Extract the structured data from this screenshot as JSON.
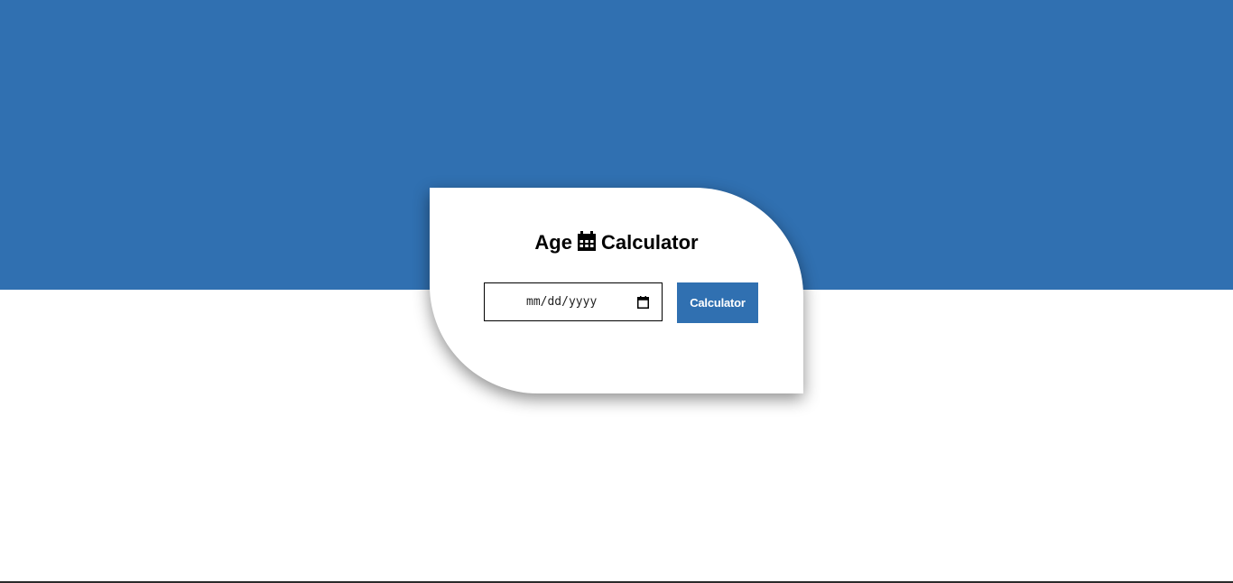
{
  "header": {
    "title_left": "Age",
    "title_icon": "calendar-icon",
    "title_right": "Calculator"
  },
  "form": {
    "date_placeholder": "mm/dd/yyyy",
    "date_value": "",
    "submit_label": "Calculator"
  },
  "colors": {
    "accent": "#3070b1",
    "card_background": "#ffffff",
    "text": "#000000"
  }
}
